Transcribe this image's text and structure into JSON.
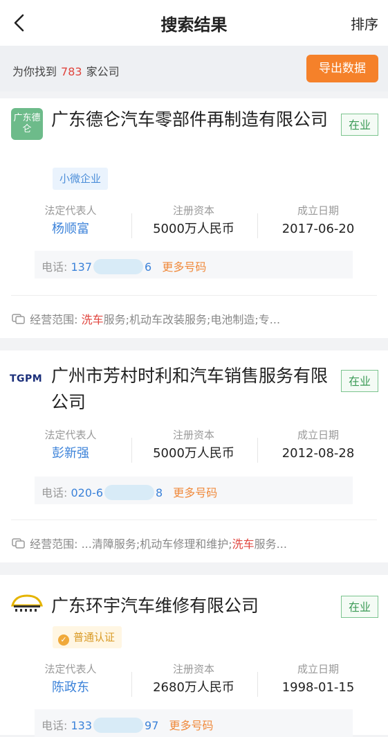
{
  "nav": {
    "title": "搜索结果",
    "sort_label": "排序"
  },
  "summary": {
    "prefix": "为你找到",
    "count": "783",
    "suffix": "家公司",
    "export_label": "导出数据"
  },
  "companies": [
    {
      "logo_text": "广东德仑",
      "name": "广东德仑汽车零部件再制造有限公司",
      "status": "在业",
      "tag": "小微企业",
      "rep_label": "法定代表人",
      "rep": "杨顺富",
      "capital_label": "注册资本",
      "capital": "5000万人民币",
      "date_label": "成立日期",
      "date": "2017-06-20",
      "phone_label": "电话:",
      "phone_prefix": "137",
      "phone_suffix": "6",
      "more_numbers": "更多号码",
      "scope_label": "经营范围:",
      "scope_pre": "",
      "scope_hl": "洗车",
      "scope_post": "服务;机动车改装服务;电池制造;专..."
    },
    {
      "logo_text": "TGPM",
      "name": "广州市芳村时利和汽车销售服务有限公司",
      "status": "在业",
      "rep_label": "法定代表人",
      "rep": "彭新强",
      "capital_label": "注册资本",
      "capital": "5000万人民币",
      "date_label": "成立日期",
      "date": "2012-08-28",
      "phone_label": "电话:",
      "phone_prefix": "020-6",
      "phone_suffix": "8",
      "more_numbers": "更多号码",
      "scope_label": "经营范围:",
      "scope_pre": "...清障服务;机动车修理和维护;",
      "scope_hl": "洗车",
      "scope_post": "服务..."
    },
    {
      "name": "广东环宇汽车维修有限公司",
      "status": "在业",
      "tag": "普通认证",
      "rep_label": "法定代表人",
      "rep": "陈政东",
      "capital_label": "注册资本",
      "capital": "2680万人民币",
      "date_label": "成立日期",
      "date": "1998-01-15",
      "phone_label": "电话:",
      "phone_prefix": "133",
      "phone_suffix": "97",
      "more_numbers": "更多号码"
    }
  ],
  "colors": {
    "accent_orange": "#f5812a",
    "link_blue": "#3b82d9",
    "status_green": "#3a9a55",
    "highlight_red": "#e0443d"
  },
  "icons": [
    "back-arrow-icon",
    "scope-icon",
    "certified-badge-icon"
  ]
}
